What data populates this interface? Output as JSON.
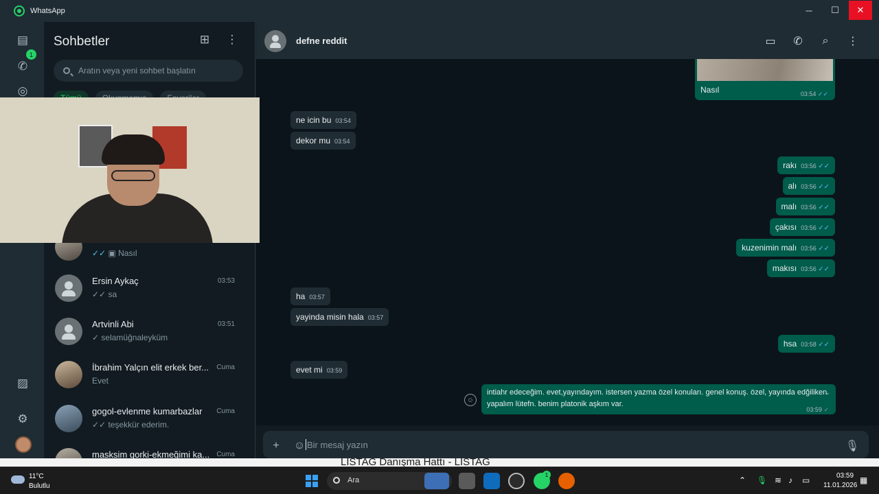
{
  "window": {
    "title": "WhatsApp",
    "minimize": "─",
    "maximize": "☐",
    "close": "✕"
  },
  "rail": {
    "unread_badge": "1"
  },
  "list": {
    "title": "Sohbetler",
    "search_placeholder": "Aratın veya yeni sohbet başlatın",
    "filters": [
      "Tümü",
      "Okunmamış",
      "Favoriler"
    ],
    "chats": [
      {
        "name": "",
        "time": "",
        "preview": "Nasıl",
        "ticks": "✓✓",
        "has_image_icon": true
      },
      {
        "name": "Ersin Aykaç",
        "time": "03:53",
        "preview": "sa",
        "ticks": "✓✓"
      },
      {
        "name": "Artvinli Abi",
        "time": "03:51",
        "preview": "selamüğnaleyküm",
        "ticks": "✓"
      },
      {
        "name": "İbrahim Yalçın elit erkek ber...",
        "time": "Cuma",
        "preview": "Evet",
        "ticks": ""
      },
      {
        "name": "gogol-evlenme kumarbazlar",
        "time": "Cuma",
        "preview": "teşekkür ederim.",
        "ticks": "✓✓"
      },
      {
        "name": "masksim gorki-ekmeğimi ka...",
        "time": "Cuma",
        "preview": "",
        "ticks": ""
      }
    ]
  },
  "chat": {
    "contact_name": "defne reddit",
    "image_caption": "Nasıl",
    "image_time": "03:54",
    "messages": [
      {
        "dir": "in",
        "text": "ne icin bu",
        "time": "03:54"
      },
      {
        "dir": "in",
        "text": "dekor mu",
        "time": "03:54"
      },
      {
        "dir": "out",
        "text": "rakı",
        "time": "03:56"
      },
      {
        "dir": "out",
        "text": "alı",
        "time": "03:56"
      },
      {
        "dir": "out",
        "text": "malı",
        "time": "03:56"
      },
      {
        "dir": "out",
        "text": "çakısı",
        "time": "03:56"
      },
      {
        "dir": "out",
        "text": "kuzenimin malı",
        "time": "03:56"
      },
      {
        "dir": "out",
        "text": "makısı",
        "time": "03:56"
      },
      {
        "dir": "in",
        "text": "ha",
        "time": "03:57"
      },
      {
        "dir": "in",
        "text": "yayinda misin hala",
        "time": "03:57"
      },
      {
        "dir": "out",
        "text": "hsa",
        "time": "03:58"
      },
      {
        "dir": "in",
        "text": "evet mi",
        "time": "03:59"
      }
    ],
    "long_message": {
      "text": "intiahr edeceğim. evet,yayındayım. istersen yazma özel konuları. genel konuş. özel, yayında edğiliken yapalım lütefn. benim platonik aşkım var.",
      "time": "03:59"
    },
    "composer_placeholder": "Bir mesaj yazın"
  },
  "behind_window_text": "LISTAG Danışma Hattı - LISTAG",
  "taskbar": {
    "weather_temp": "11°C",
    "weather_desc": "Bulutlu",
    "search_label": "Ara",
    "whatsapp_badge": "1",
    "time": "03:59",
    "date": "11.01.2026"
  }
}
